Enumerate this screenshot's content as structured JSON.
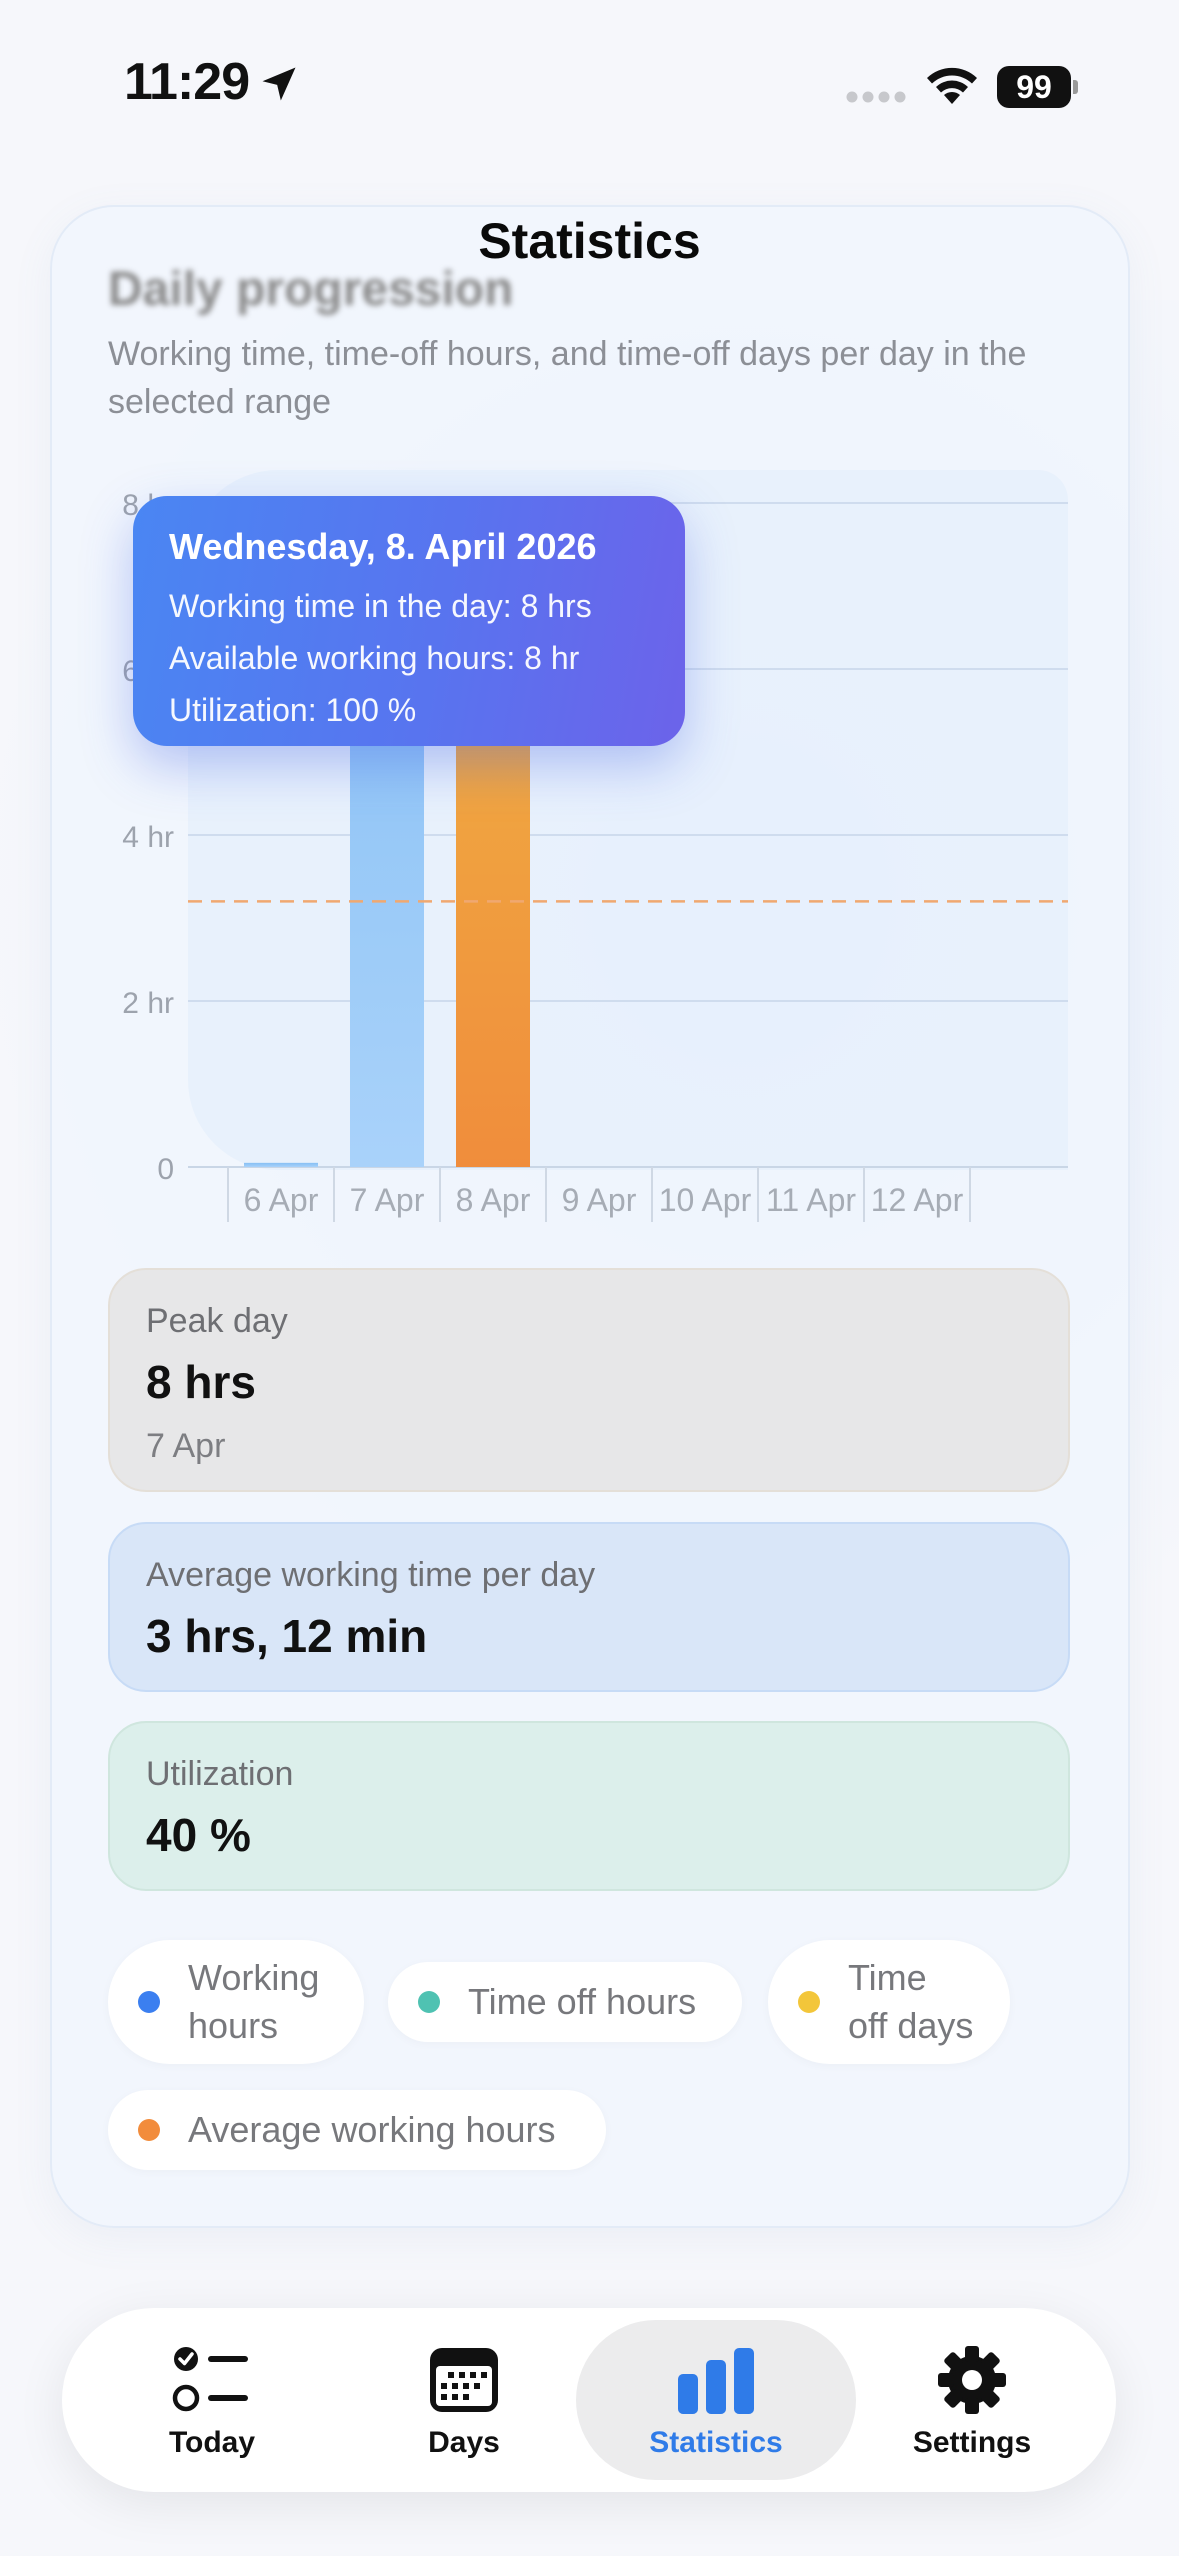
{
  "status_bar": {
    "time": "11:29",
    "battery": "99"
  },
  "nav": {
    "title": "Statistics"
  },
  "section": {
    "title": "Daily progression",
    "subtitle": "Working time, time-off hours, and time-off days per day in the selected range"
  },
  "tooltip": {
    "title": "Wednesday, 8. April 2026",
    "line1": "Working time in the day: 8 hrs",
    "line2": "Available working hours: 8 hr",
    "line3": "Utilization: 100 %"
  },
  "chart_data": {
    "type": "bar",
    "categories": [
      "6 Apr",
      "7 Apr",
      "8 Apr",
      "9 Apr",
      "10 Apr",
      "11 Apr",
      "12 Apr"
    ],
    "series": [
      {
        "name": "Working hours",
        "values": [
          0.05,
          8,
          8,
          0,
          0,
          0,
          0
        ],
        "color": "#8ec3f6"
      }
    ],
    "highlight_index": 2,
    "highlight_color": "#f3a43f",
    "average_line": {
      "name": "Average working hours",
      "value": 3.2,
      "color": "#f0a870"
    },
    "y_ticks": [
      "0",
      "2 hr",
      "4 hr",
      "6 hr",
      "8 hr"
    ],
    "y_tick_values": [
      0,
      2,
      4,
      6,
      8
    ],
    "ylim": [
      0,
      8
    ],
    "grid": true
  },
  "stats": {
    "peak": {
      "label": "Peak day",
      "value": "8 hrs",
      "date": "7 Apr"
    },
    "avg": {
      "label": "Average working time per day",
      "value": "3 hrs, 12 min"
    },
    "util": {
      "label": "Utilization",
      "value": "40 %"
    }
  },
  "legend": [
    {
      "label": "Working hours",
      "color": "#3b7ff0"
    },
    {
      "label": "Time off hours",
      "color": "#4fc2b2"
    },
    {
      "label": "Time off days",
      "color": "#f3c63a"
    },
    {
      "label": "Average working hours",
      "color": "#f28c3c"
    }
  ],
  "tabs": [
    {
      "label": "Today",
      "icon": "checklist-icon"
    },
    {
      "label": "Days",
      "icon": "calendar-icon"
    },
    {
      "label": "Statistics",
      "icon": "bar-chart-icon",
      "active": true,
      "color": "#2f7be8"
    },
    {
      "label": "Settings",
      "icon": "gear-icon"
    }
  ]
}
